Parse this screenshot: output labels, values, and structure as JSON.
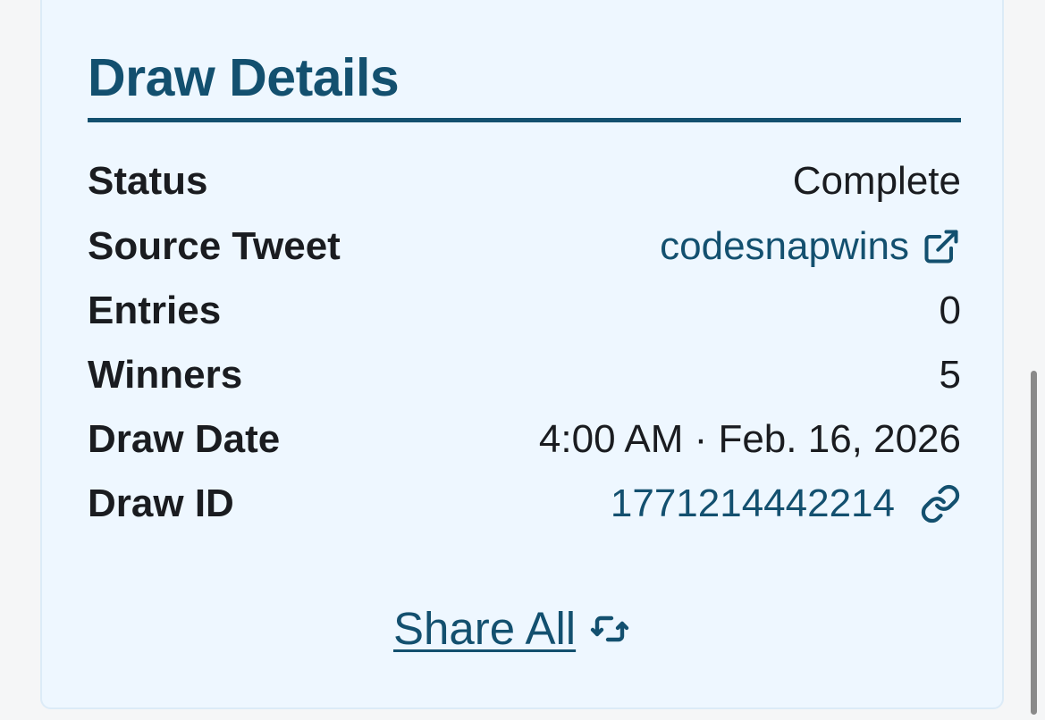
{
  "panel": {
    "title": "Draw Details"
  },
  "details": {
    "status_label": "Status",
    "status_value": "Complete",
    "source_label": "Source Tweet",
    "source_value": "codesnapwins",
    "entries_label": "Entries",
    "entries_value": "0",
    "winners_label": "Winners",
    "winners_value": "5",
    "date_label": "Draw Date",
    "date_value": "4:00 AM · Feb. 16, 2026",
    "id_label": "Draw ID",
    "id_value": "1771214442214"
  },
  "actions": {
    "share_label": "Share All"
  },
  "icons": {
    "source_link": "external-link-icon",
    "draw_id_link": "link-icon",
    "share_all": "repeat-icon"
  },
  "colors": {
    "accent": "#13506f",
    "text": "#1a1c20",
    "panel_background": "#eef7ff",
    "panel_border": "#dcebf7",
    "page_background": "#f5f6f7"
  }
}
